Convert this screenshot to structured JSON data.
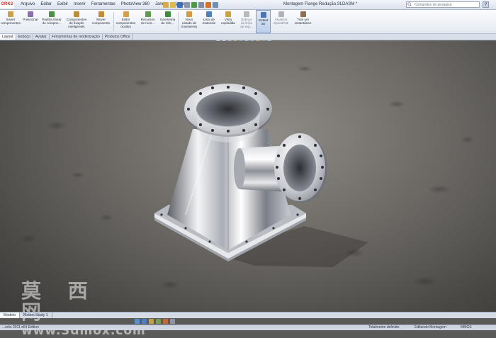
{
  "app": {
    "logo_text": "ORKS",
    "doc_title": "Montagem Flange Redução.SLDASM *"
  },
  "menu": [
    "Arquivo",
    "Editar",
    "Exibir",
    "Inserir",
    "Ferramentas",
    "PhotoView 360",
    "Janela",
    "Ajuda"
  ],
  "search": {
    "placeholder": "Comandos de pesquisa"
  },
  "help_label": "?",
  "ribbon": [
    {
      "label": "Inserir\ncomponentes"
    },
    {
      "label": "Posicionar"
    },
    {
      "label": "Padrão linear\nde compon..."
    },
    {
      "label": "Componentes\nde fixação\ninteligentes"
    },
    {
      "label": "Mover\ncomponente"
    },
    {
      "label": "Exibir\ncomponentes\nocultos"
    },
    {
      "label": "Recursos\nde mon..."
    },
    {
      "label": "Geometria\nde refe..."
    },
    {
      "label": "Novo\nestudo de\nmovimento"
    },
    {
      "label": "Lista de\nmateriais"
    },
    {
      "label": "Vista\nexplodida"
    },
    {
      "label": "Esboço\nda linha\nde exp..."
    },
    {
      "label": "Instant\n3D"
    },
    {
      "label": "Atualizar\nSpeedPak"
    },
    {
      "label": "Tirar um\ninstantâneo"
    }
  ],
  "command_tabs": [
    "Layout",
    "Esboço",
    "Avaliar",
    "Ferramentas de renderização",
    "Produtos Office"
  ],
  "bottom_tabs": [
    "Modelo",
    "Motion Study 1"
  ],
  "status": {
    "left": "...orks 2011 x64 Edition",
    "mid": "Totalmente definido",
    "right": "Editando Montagem",
    "units": "MMGS"
  },
  "watermark": {
    "chars": "莫 西 网",
    "url": "www.3dmox.com"
  },
  "colors": {
    "title_bg": "#e3e9f2",
    "ribbon_bg": "#eef2f7",
    "viewport_bg": "#6b6864",
    "logo_red": "#d12a21"
  },
  "scene": {
    "object": "flange reduction assembly (steel)"
  }
}
